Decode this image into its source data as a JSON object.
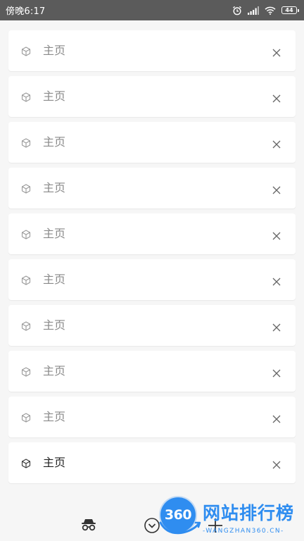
{
  "status_bar": {
    "time": "傍晚6:17",
    "battery": "44",
    "icons": [
      "alarm-icon",
      "signal-icon",
      "wifi-icon",
      "battery-icon"
    ]
  },
  "tabs": [
    {
      "title": "主页",
      "icon": "cube-icon",
      "active": false
    },
    {
      "title": "主页",
      "icon": "cube-icon",
      "active": false
    },
    {
      "title": "主页",
      "icon": "cube-icon",
      "active": false
    },
    {
      "title": "主页",
      "icon": "cube-icon",
      "active": false
    },
    {
      "title": "主页",
      "icon": "cube-icon",
      "active": false
    },
    {
      "title": "主页",
      "icon": "cube-icon",
      "active": false
    },
    {
      "title": "主页",
      "icon": "cube-icon",
      "active": false
    },
    {
      "title": "主页",
      "icon": "cube-icon",
      "active": false
    },
    {
      "title": "主页",
      "icon": "cube-icon",
      "active": false
    },
    {
      "title": "主页",
      "icon": "cube-icon",
      "active": true
    }
  ],
  "bottom_bar": {
    "icons": [
      "incognito-icon",
      "collapse-tabs-icon",
      "add-tab-icon"
    ]
  },
  "watermark": {
    "badge": "360",
    "title": "网站排行榜",
    "subtitle": "-WANGZHAN360.CN-"
  },
  "colors": {
    "status_bar": "#5b5b5b",
    "background": "#f6f6f6",
    "card": "#ffffff",
    "inactive_text": "#8a8a8a",
    "active_text": "#222222",
    "watermark_blue": "#2f8df0"
  }
}
